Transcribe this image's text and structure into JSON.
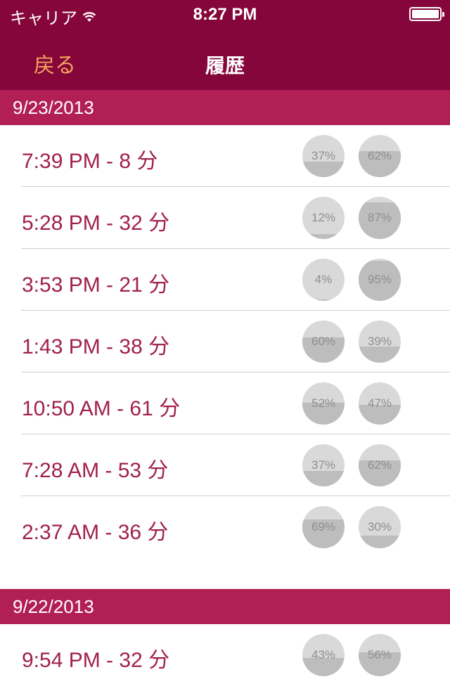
{
  "status_bar": {
    "carrier": "キャリア",
    "time": "8:27 PM"
  },
  "nav": {
    "back_label": "戻る",
    "title": "履歴"
  },
  "colors": {
    "nav_bg": "#85063a",
    "section_bg": "#b11f55",
    "accent_text": "#a1204f",
    "back_text": "#f3a35d"
  },
  "sections": [
    {
      "date": "9/23/2013",
      "rows": [
        {
          "label": "7:39 PM - 8 分",
          "left_pct": "37%",
          "right_pct": "62%",
          "left_value": 0.37,
          "right_value": 0.62
        },
        {
          "label": "5:28 PM - 32 分",
          "left_pct": "12%",
          "right_pct": "87%",
          "left_value": 0.12,
          "right_value": 0.87
        },
        {
          "label": "3:53 PM - 21 分",
          "left_pct": "4%",
          "right_pct": "95%",
          "left_value": 0.04,
          "right_value": 0.95
        },
        {
          "label": "1:43 PM - 38 分",
          "left_pct": "60%",
          "right_pct": "39%",
          "left_value": 0.6,
          "right_value": 0.39
        },
        {
          "label": "10:50 AM - 61 分",
          "left_pct": "52%",
          "right_pct": "47%",
          "left_value": 0.52,
          "right_value": 0.47
        },
        {
          "label": "7:28 AM - 53 分",
          "left_pct": "37%",
          "right_pct": "62%",
          "left_value": 0.37,
          "right_value": 0.62
        },
        {
          "label": "2:37 AM - 36 分",
          "left_pct": "69%",
          "right_pct": "30%",
          "left_value": 0.69,
          "right_value": 0.3
        }
      ]
    },
    {
      "date": "9/22/2013",
      "rows": [
        {
          "label": "9:54 PM - 32 分",
          "left_pct": "43%",
          "right_pct": "56%",
          "left_value": 0.43,
          "right_value": 0.56
        }
      ]
    }
  ]
}
